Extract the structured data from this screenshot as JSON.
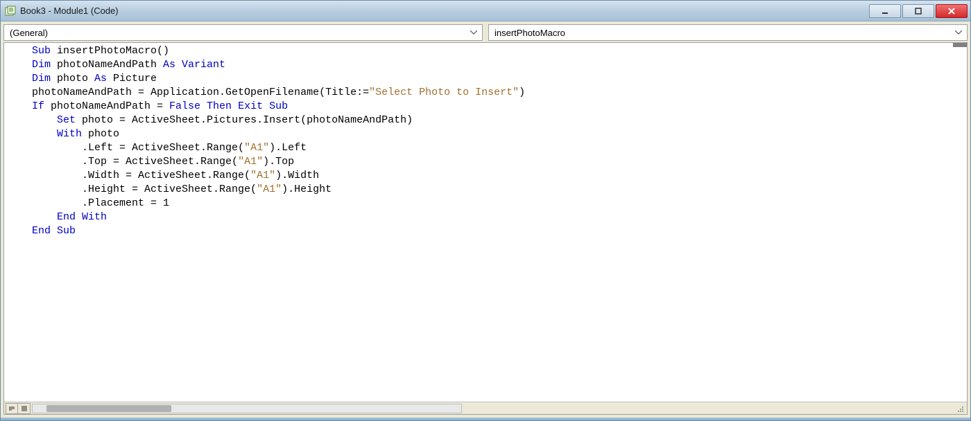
{
  "window": {
    "title": "Book3 - Module1 (Code)"
  },
  "dropdowns": {
    "object": "(General)",
    "procedure": "insertPhotoMacro"
  },
  "code": {
    "lines": [
      {
        "indent": 0,
        "tokens": [
          {
            "t": "kw",
            "v": "Sub"
          },
          {
            "t": "",
            "v": " insertPhotoMacro()"
          }
        ]
      },
      {
        "indent": 0,
        "tokens": [
          {
            "t": "kw",
            "v": "Dim"
          },
          {
            "t": "",
            "v": " photoNameAndPath "
          },
          {
            "t": "kw",
            "v": "As Variant"
          }
        ]
      },
      {
        "indent": 0,
        "tokens": [
          {
            "t": "kw",
            "v": "Dim"
          },
          {
            "t": "",
            "v": " photo "
          },
          {
            "t": "kw",
            "v": "As"
          },
          {
            "t": "",
            "v": " Picture"
          }
        ]
      },
      {
        "indent": 0,
        "tokens": [
          {
            "t": "",
            "v": "photoNameAndPath = Application.GetOpenFilename(Title:="
          },
          {
            "t": "str",
            "v": "\"Select Photo to Insert\""
          },
          {
            "t": "",
            "v": ")"
          }
        ]
      },
      {
        "indent": 0,
        "tokens": [
          {
            "t": "kw",
            "v": "If"
          },
          {
            "t": "",
            "v": " photoNameAndPath = "
          },
          {
            "t": "kw",
            "v": "False Then Exit Sub"
          }
        ]
      },
      {
        "indent": 1,
        "tokens": [
          {
            "t": "kw",
            "v": "Set"
          },
          {
            "t": "",
            "v": " photo = ActiveSheet.Pictures.Insert(photoNameAndPath)"
          }
        ]
      },
      {
        "indent": 1,
        "tokens": [
          {
            "t": "kw",
            "v": "With"
          },
          {
            "t": "",
            "v": " photo"
          }
        ]
      },
      {
        "indent": 2,
        "tokens": [
          {
            "t": "",
            "v": ".Left = ActiveSheet.Range("
          },
          {
            "t": "str",
            "v": "\"A1\""
          },
          {
            "t": "",
            "v": ").Left"
          }
        ]
      },
      {
        "indent": 2,
        "tokens": [
          {
            "t": "",
            "v": ".Top = ActiveSheet.Range("
          },
          {
            "t": "str",
            "v": "\"A1\""
          },
          {
            "t": "",
            "v": ").Top"
          }
        ]
      },
      {
        "indent": 2,
        "tokens": [
          {
            "t": "",
            "v": ".Width = ActiveSheet.Range("
          },
          {
            "t": "str",
            "v": "\"A1\""
          },
          {
            "t": "",
            "v": ").Width"
          }
        ]
      },
      {
        "indent": 2,
        "tokens": [
          {
            "t": "",
            "v": ".Height = ActiveSheet.Range("
          },
          {
            "t": "str",
            "v": "\"A1\""
          },
          {
            "t": "",
            "v": ").Height"
          }
        ]
      },
      {
        "indent": 2,
        "tokens": [
          {
            "t": "",
            "v": ".Placement = 1"
          }
        ]
      },
      {
        "indent": 0,
        "tokens": [
          {
            "t": "",
            "v": ""
          }
        ]
      },
      {
        "indent": 1,
        "tokens": [
          {
            "t": "kw",
            "v": "End With"
          }
        ]
      },
      {
        "indent": 0,
        "tokens": [
          {
            "t": "kw",
            "v": "End Sub"
          }
        ]
      }
    ]
  }
}
